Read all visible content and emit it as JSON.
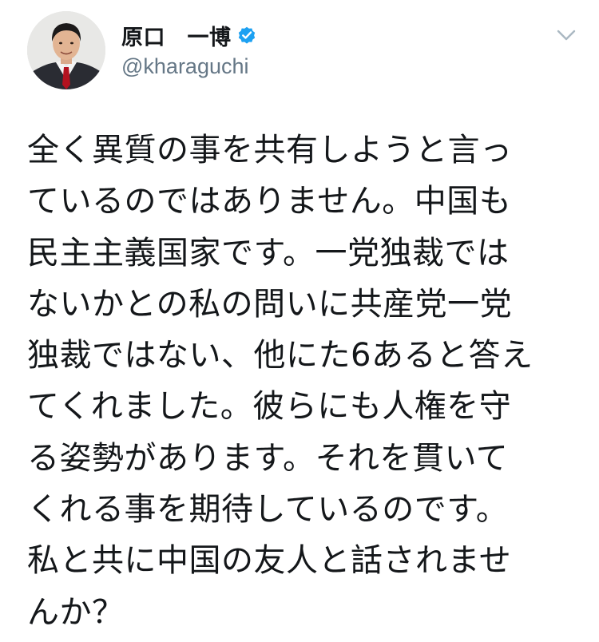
{
  "tweet": {
    "author": {
      "display_name": "原口　一博",
      "handle": "@kharaguchi",
      "verified": true
    },
    "menu_icon": "chevron-down-icon",
    "text_lines": [
      "全く異質の事を共有しようと言っ",
      "ているのではありません。中国も",
      "民主主義国家です。一党独裁では",
      "ないかとの私の問いに共産党一党",
      "独裁ではない、他にた6あると答え",
      "てくれました。彼らにも人権を守",
      "る姿勢があります。それを貫いて",
      "くれる事を期待しているのです。",
      "私と共に中国の友人と話されませ",
      "んか？"
    ]
  },
  "colors": {
    "text": "#14171a",
    "handle": "#657786",
    "verified_badge": "#1da1f2",
    "caret": "#aab8c2"
  }
}
